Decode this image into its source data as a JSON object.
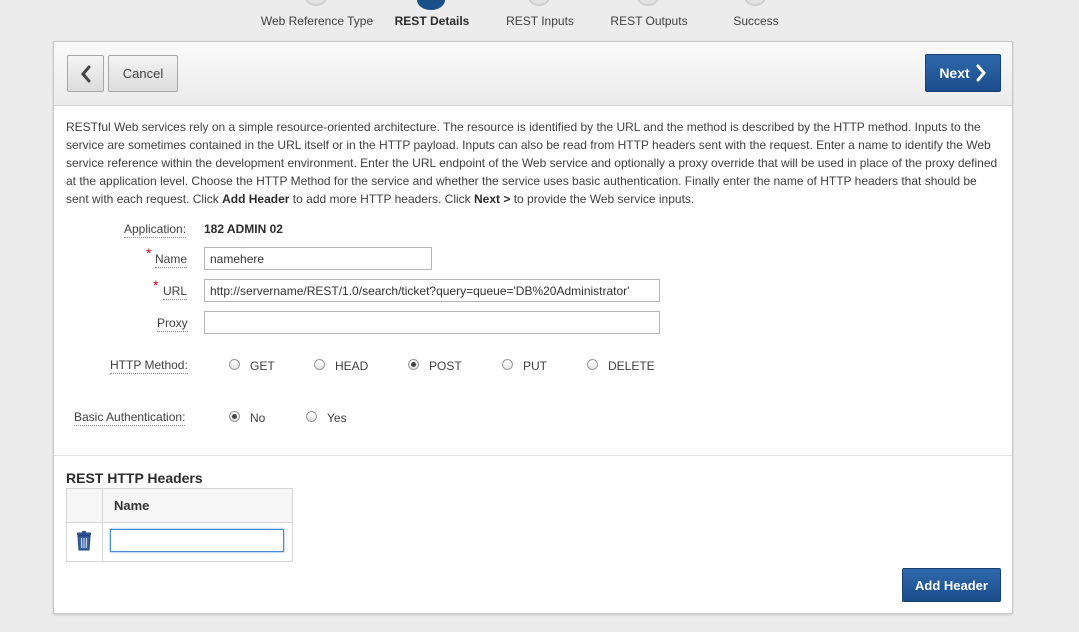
{
  "wizard": {
    "steps": [
      {
        "label": "Web Reference Type",
        "active": false
      },
      {
        "label": "REST Details",
        "active": true
      },
      {
        "label": "REST Inputs",
        "active": false
      },
      {
        "label": "REST Outputs",
        "active": false
      },
      {
        "label": "Success",
        "active": false
      }
    ]
  },
  "toolbar": {
    "back_icon": "chevron-left-icon",
    "cancel_label": "Cancel",
    "next_label": "Next",
    "next_icon": "chevron-right-icon"
  },
  "description": {
    "part1": "RESTful Web services rely on a simple resource-oriented architecture. The resource is identified by the URL and the method is described by the HTTP method. Inputs to the service are sometimes contained in the URL itself or in the HTTP payload. Inputs can also be read from HTTP headers sent with the request. Enter a name to identify the Web service reference within the development environment. Enter the URL endpoint of the Web service and optionally a proxy override that will be used in place of the proxy defined at the application level. Choose the HTTP Method for the service and whether the service uses basic authentication. Finally enter the name of HTTP headers that should be sent with each request. Click",
    "bold1": "Add Header",
    "part2": "to add more HTTP headers. Click",
    "bold2": "Next >",
    "part3": "to provide the Web service inputs."
  },
  "form": {
    "application_label": "Application:",
    "application_value": "182 ADMIN 02",
    "name_label": "Name",
    "name_value": "namehere",
    "url_label": "URL",
    "url_value": "http://servername/REST/1.0/search/ticket?query=queue='DB%20Administrator'",
    "proxy_label": "Proxy",
    "proxy_value": "",
    "required_marker": "*",
    "http_method_label": "HTTP Method:",
    "http_methods": [
      {
        "label": "GET",
        "selected": false
      },
      {
        "label": "HEAD",
        "selected": false
      },
      {
        "label": "POST",
        "selected": true
      },
      {
        "label": "PUT",
        "selected": false
      },
      {
        "label": "DELETE",
        "selected": false
      }
    ],
    "basic_auth_label": "Basic Authentication:",
    "basic_auth_options": [
      {
        "label": "No",
        "selected": true
      },
      {
        "label": "Yes",
        "selected": false
      }
    ]
  },
  "headers": {
    "title": "REST HTTP Headers",
    "column_name": "Name",
    "delete_icon": "trash-icon",
    "row_value": "",
    "add_label": "Add Header"
  }
}
